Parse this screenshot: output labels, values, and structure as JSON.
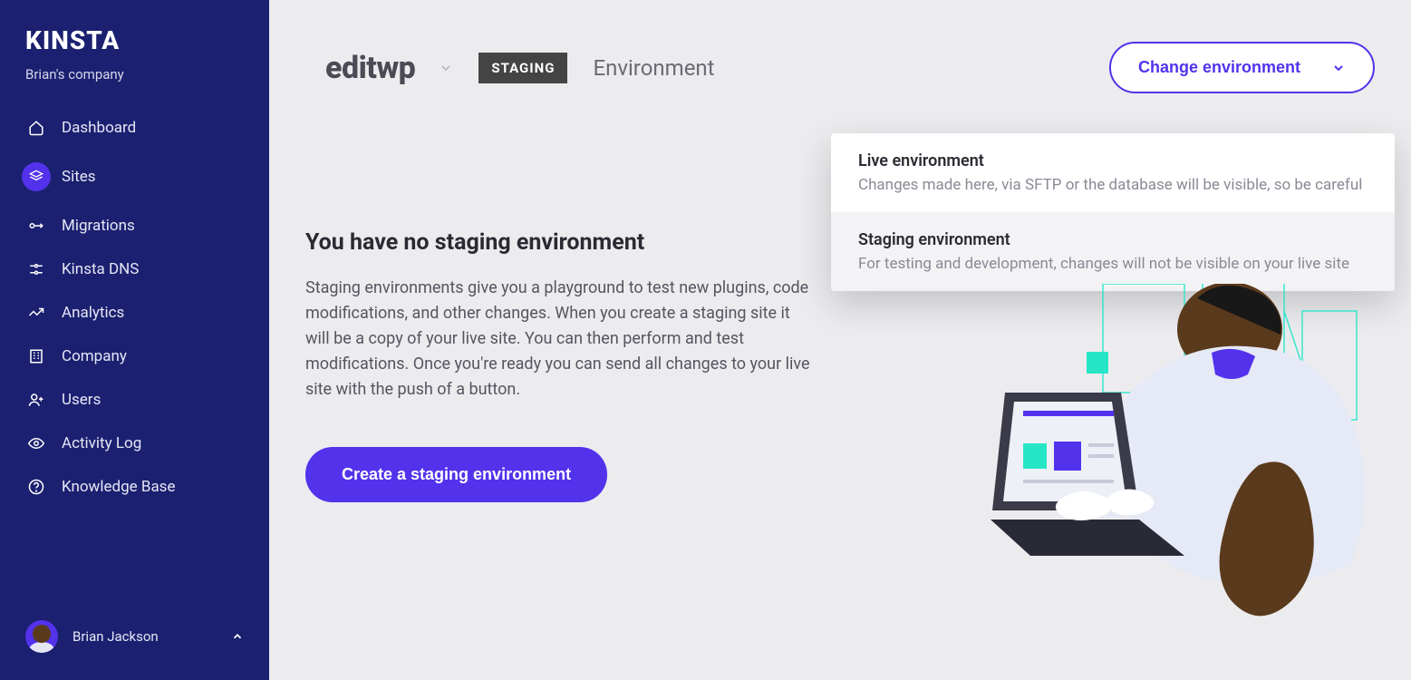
{
  "brand": "KINSTA",
  "company_name": "Brian's company",
  "sidebar": {
    "items": [
      {
        "label": "Dashboard",
        "icon": "home"
      },
      {
        "label": "Sites",
        "icon": "layers",
        "active": true
      },
      {
        "label": "Migrations",
        "icon": "plug"
      },
      {
        "label": "Kinsta DNS",
        "icon": "dns"
      },
      {
        "label": "Analytics",
        "icon": "trend"
      },
      {
        "label": "Company",
        "icon": "building"
      },
      {
        "label": "Users",
        "icon": "user-plus"
      },
      {
        "label": "Activity Log",
        "icon": "eye"
      },
      {
        "label": "Knowledge Base",
        "icon": "help"
      }
    ]
  },
  "user": {
    "name": "Brian Jackson"
  },
  "header": {
    "site_name": "editwp",
    "env_badge": "STAGING",
    "env_label": "Environment",
    "change_btn": "Change environment"
  },
  "dropdown": {
    "items": [
      {
        "title": "Live environment",
        "subtitle": "Changes made here, via SFTP or the database will be visible, so be careful",
        "selected": false
      },
      {
        "title": "Staging environment",
        "subtitle": "For testing and development, changes will not be visible on your live site",
        "selected": true
      }
    ]
  },
  "content": {
    "heading": "You have no staging environment",
    "body": "Staging environments give you a playground to test new plugins, code modifications, and other changes. When you create a staging site it will be a copy of your live site. You can then perform and test modifications. Once you're ready you can send all changes to your live site with the push of a button.",
    "cta": "Create a staging environment"
  }
}
